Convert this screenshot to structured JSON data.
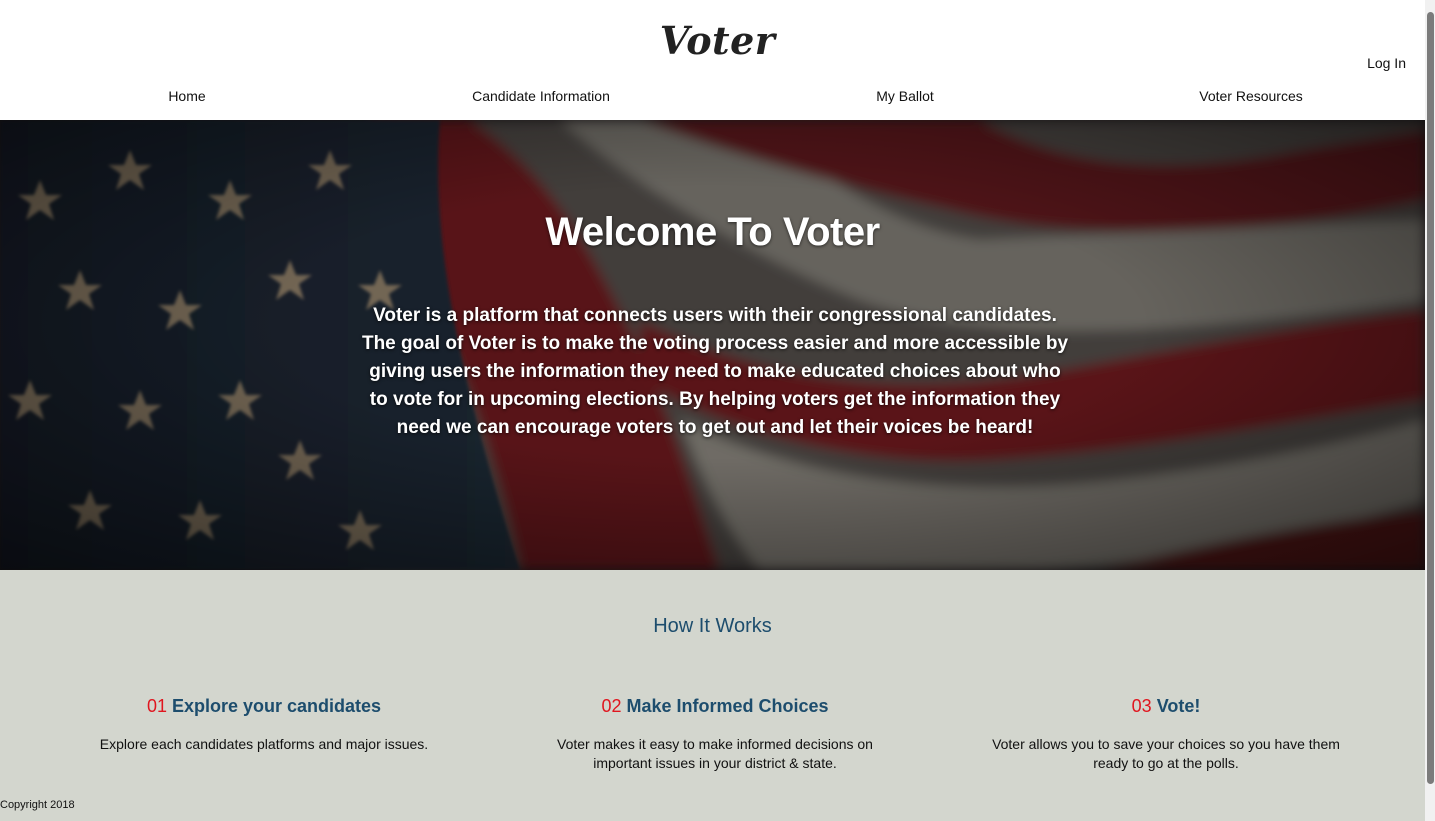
{
  "header": {
    "logo": "Voter",
    "login_label": "Log In",
    "nav": [
      {
        "label": "Home"
      },
      {
        "label": "Candidate Information"
      },
      {
        "label": "My Ballot"
      },
      {
        "label": "Voter Resources"
      }
    ]
  },
  "hero": {
    "title": "Welcome To Voter",
    "description": "Voter is a platform that connects users with their congressional candidates. The goal of Voter is to make the voting process easier and more accessible by giving users the information they need to make educated choices about who to vote for in upcoming elections. By helping voters get the information they need we can encourage voters to get out and let their voices be heard!",
    "background": "american-flag-photo"
  },
  "how_it_works": {
    "title": "How It Works",
    "steps": [
      {
        "number": "01",
        "title": "Explore your candidates",
        "description": "Explore each candidates platforms and major issues."
      },
      {
        "number": "02",
        "title": "Make Informed Choices",
        "description": "Voter makes it easy to make informed decisions on important issues in your district & state."
      },
      {
        "number": "03",
        "title": "Vote!",
        "description": "Voter allows you to save your choices so you have them ready to go at the polls."
      }
    ]
  },
  "footer": {
    "copyright": "Copyright 2018"
  },
  "colors": {
    "accent_number": "#e0161f",
    "heading_blue": "#1d4d6d",
    "section_bg": "#d3d6ce"
  }
}
